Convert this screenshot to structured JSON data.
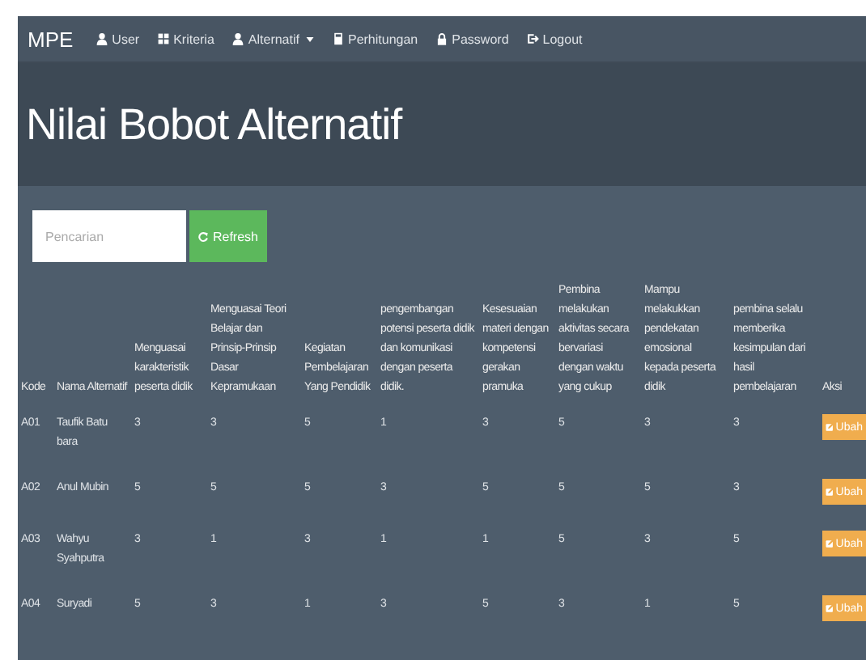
{
  "navbar": {
    "brand": "MPE",
    "items": [
      {
        "label": "User",
        "kind": "user",
        "dropdown": false
      },
      {
        "label": "Kriteria",
        "kind": "grid",
        "dropdown": false
      },
      {
        "label": "Alternatif",
        "kind": "user",
        "dropdown": true
      },
      {
        "label": "Perhitungan",
        "kind": "calc",
        "dropdown": false
      },
      {
        "label": "Password",
        "kind": "lock",
        "dropdown": false
      },
      {
        "label": "Logout",
        "kind": "logout",
        "dropdown": false
      }
    ]
  },
  "page_title": "Nilai Bobot Alternatif",
  "search": {
    "placeholder": "Pencarian"
  },
  "refresh_button": "Refresh",
  "table": {
    "columns": [
      "Kode",
      "Nama Alternatif",
      "Menguasai karakteristik peserta didik",
      "Menguasai Teori Belajar dan Prinsip-Prinsip Dasar Kepramukaan",
      "Kegiatan Pembelajaran Yang Pendidik",
      "pengembangan potensi peserta didik dan komunikasi dengan peserta didik.",
      "Kesesuaian materi dengan kompetensi gerakan pramuka",
      "Pembina melakukan aktivitas secara bervariasi dengan waktu yang cukup",
      "Mampu melakukkan pendekatan emosional kepada peserta didik",
      "pembina selalu memberika kesimpulan dari hasil pembelajaran",
      "Aksi"
    ],
    "rows": [
      {
        "kode": "A01",
        "nama": "Taufik Batu bara",
        "values": [
          "3",
          "3",
          "5",
          "1",
          "3",
          "5",
          "3",
          "3"
        ],
        "action": "Ubah"
      },
      {
        "kode": "A02",
        "nama": "Anul Mubin",
        "values": [
          "5",
          "5",
          "5",
          "3",
          "5",
          "5",
          "5",
          "3"
        ],
        "action": "Ubah"
      },
      {
        "kode": "A03",
        "nama": "Wahyu Syahputra",
        "values": [
          "3",
          "1",
          "3",
          "1",
          "1",
          "5",
          "3",
          "5"
        ],
        "action": "Ubah"
      },
      {
        "kode": "A04",
        "nama": "Suryadi",
        "values": [
          "5",
          "3",
          "1",
          "3",
          "5",
          "3",
          "1",
          "5"
        ],
        "action": "Ubah"
      }
    ]
  }
}
